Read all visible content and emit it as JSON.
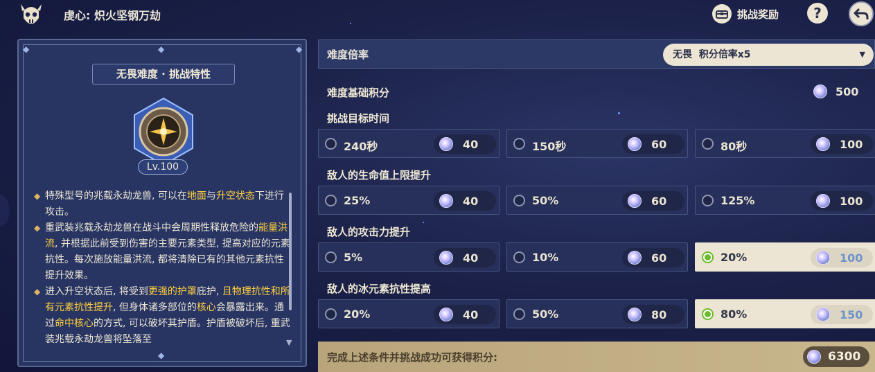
{
  "header": {
    "title": "虔心: 炽火坚钢万劫",
    "reward_label": "挑战奖励",
    "help_label": "?",
    "icons": [
      "skull-logo-icon",
      "chest-icon",
      "help-icon",
      "back-arrow-icon"
    ]
  },
  "left_panel": {
    "trait_title": "无畏难度 · 挑战特性",
    "level": "Lv.100",
    "paragraphs": [
      [
        {
          "t": "特殊型号的兆载永劫龙兽, 可以在"
        },
        {
          "t": "地面",
          "hl": true
        },
        {
          "t": "与"
        },
        {
          "t": "升空状态",
          "hl": true
        },
        {
          "t": "下进行攻击。"
        }
      ],
      [
        {
          "t": "重武装兆载永劫龙兽在战斗中会周期性释放危险的"
        },
        {
          "t": "能量洪流",
          "hl": true
        },
        {
          "t": ", 并根据此前受到伤害的主要元素类型, 提高对应的元素抗性。每次施放能量洪流, 都将清除已有的其他元素抗性提升效果。"
        }
      ],
      [
        {
          "t": "进入升空状态后, 将受到"
        },
        {
          "t": "更强的护罩",
          "hl": true
        },
        {
          "t": "庇护, "
        },
        {
          "t": "且物理抗性和所有元素抗性提升",
          "hl": true
        },
        {
          "t": ", 但身体诸多部位的"
        },
        {
          "t": "核心",
          "hl": true
        },
        {
          "t": "会暴露出来。通过"
        },
        {
          "t": "命中核心",
          "hl": true
        },
        {
          "t": "的方式, 可以破坏其护盾。护盾被破坏后, 重武装兆载永劫龙兽将坠落至"
        }
      ]
    ]
  },
  "difficulty": {
    "label": "难度倍率",
    "selected": "无畏  积分倍率x5"
  },
  "base_score": {
    "label": "难度基础积分",
    "value": "500"
  },
  "sections": [
    {
      "label": "挑战目标时间",
      "options": [
        {
          "label": "240秒",
          "points": "40",
          "selected": false
        },
        {
          "label": "150秒",
          "points": "60",
          "selected": false
        },
        {
          "label": "80秒",
          "points": "100",
          "selected": false
        }
      ]
    },
    {
      "label": "敌人的生命值上限提升",
      "options": [
        {
          "label": "25%",
          "points": "40",
          "selected": false
        },
        {
          "label": "50%",
          "points": "60",
          "selected": false
        },
        {
          "label": "125%",
          "points": "100",
          "selected": false
        }
      ]
    },
    {
      "label": "敌人的攻击力提升",
      "options": [
        {
          "label": "5%",
          "points": "40",
          "selected": false
        },
        {
          "label": "10%",
          "points": "60",
          "selected": false
        },
        {
          "label": "20%",
          "points": "100",
          "selected": true
        }
      ]
    },
    {
      "label": "敌人的冰元素抗性提高",
      "options": [
        {
          "label": "20%",
          "points": "40",
          "selected": false
        },
        {
          "label": "50%",
          "points": "80",
          "selected": false
        },
        {
          "label": "80%",
          "points": "150",
          "selected": true
        }
      ]
    }
  ],
  "footer": {
    "label": "完成上述条件并挑战成功可获得积分:",
    "total": "6300"
  },
  "colors": {
    "highlight": "#ffcf3d",
    "selected_radio": "#6dbb2c",
    "selected_points_text": "#6f94c9",
    "panel_bg": "#283563",
    "cream": "#ece5d3"
  }
}
